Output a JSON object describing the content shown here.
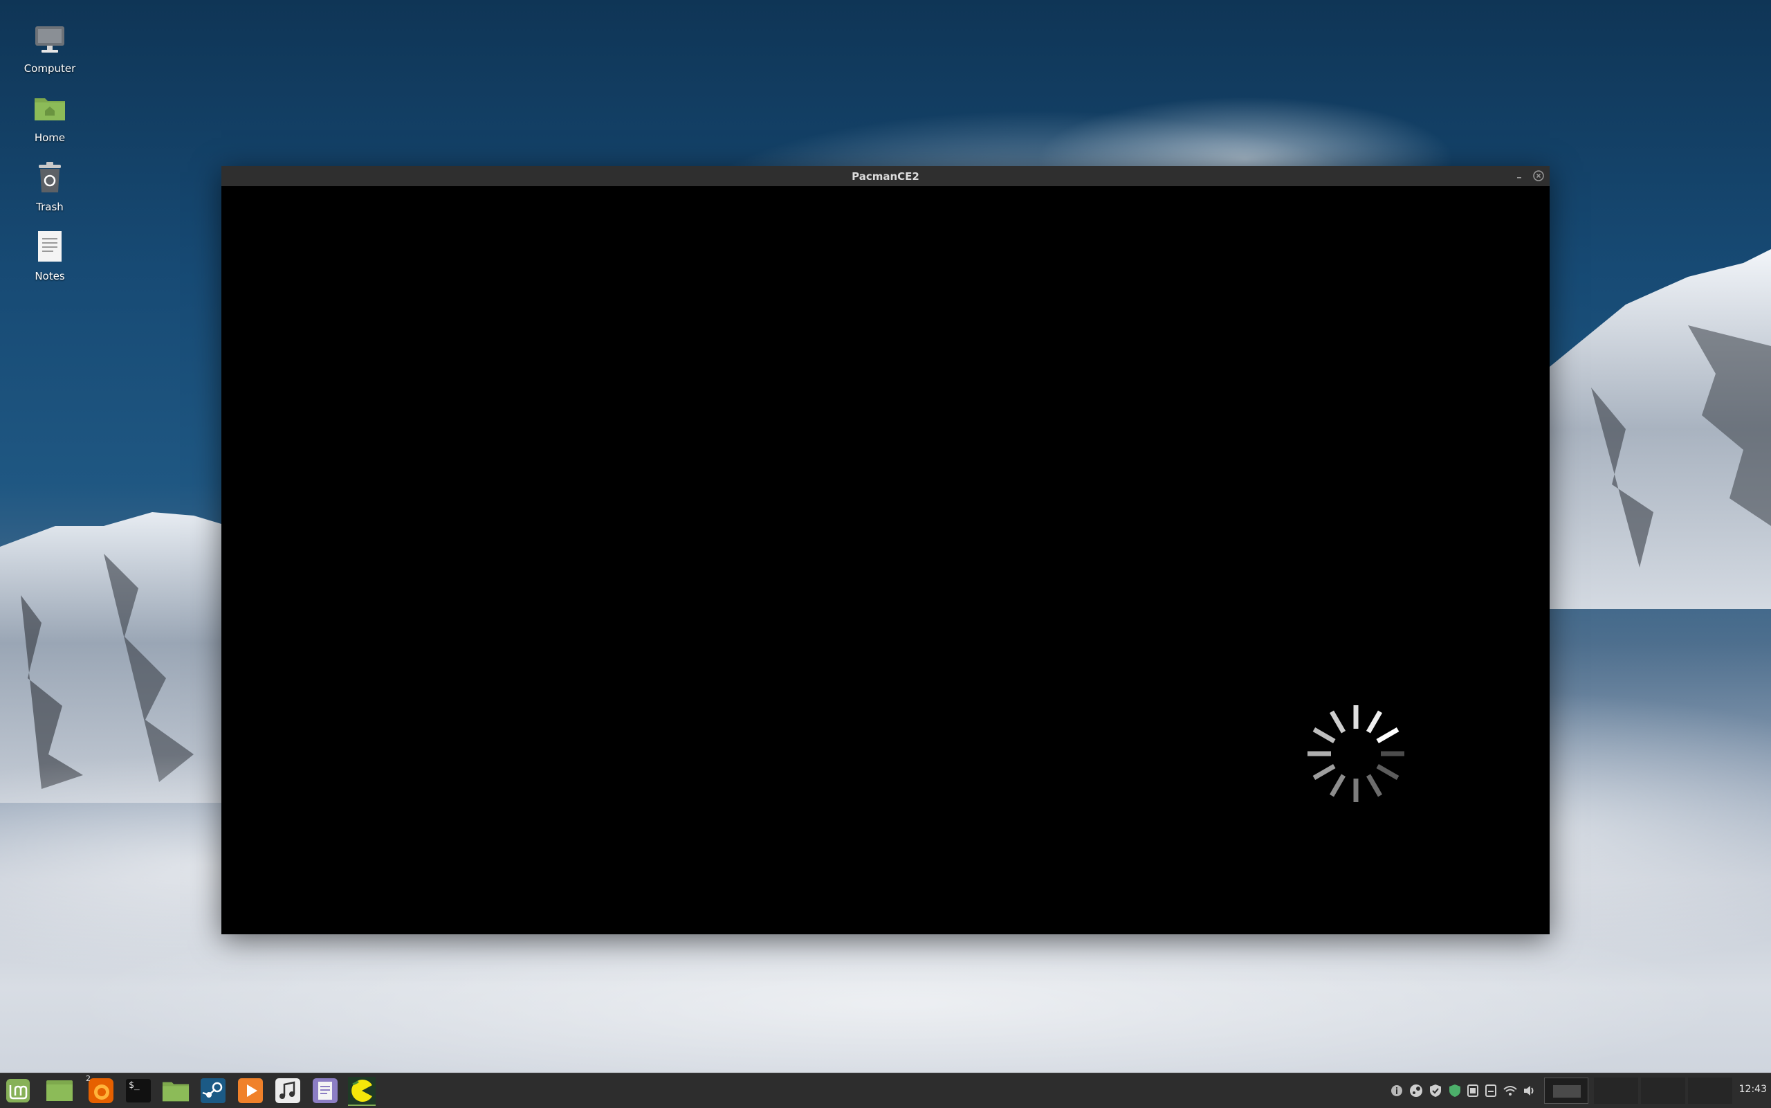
{
  "desktop": {
    "icons": [
      {
        "label": "Computer",
        "icon": "computer-icon"
      },
      {
        "label": "Home",
        "icon": "home-folder-icon"
      },
      {
        "label": "Trash",
        "icon": "trash-icon"
      },
      {
        "label": "Notes",
        "icon": "text-document-icon"
      }
    ]
  },
  "window": {
    "title": "PacmanCE2",
    "state": "loading",
    "controls": [
      "minimize-icon",
      "close-icon"
    ]
  },
  "taskbar": {
    "launchers": [
      {
        "name": "mint-menu",
        "icon": "linux-mint-icon"
      },
      {
        "name": "show-desktop",
        "icon": "show-desktop-icon"
      },
      {
        "name": "firefox",
        "icon": "firefox-icon",
        "badge": "2"
      },
      {
        "name": "terminal",
        "icon": "terminal-icon",
        "text": "$_"
      },
      {
        "name": "files",
        "icon": "folder-icon"
      },
      {
        "name": "steam",
        "icon": "steam-icon"
      },
      {
        "name": "media-player",
        "icon": "play-icon"
      },
      {
        "name": "music",
        "icon": "music-note-icon"
      },
      {
        "name": "text-editor",
        "icon": "text-editor-icon"
      },
      {
        "name": "pacman",
        "icon": "pacman-icon"
      }
    ],
    "tray": [
      "info-icon",
      "steam-tray-icon",
      "shield-icon",
      "update-icon",
      "clipboard-icon",
      "keyboard-icon",
      "wifi-icon",
      "volume-icon"
    ],
    "clock": "12:43",
    "colors": {
      "panel": "#2d2d2d",
      "mint_green": "#87b158",
      "firefox_orange": "#e66000",
      "pacman_yellow": "#f5e60a"
    }
  }
}
